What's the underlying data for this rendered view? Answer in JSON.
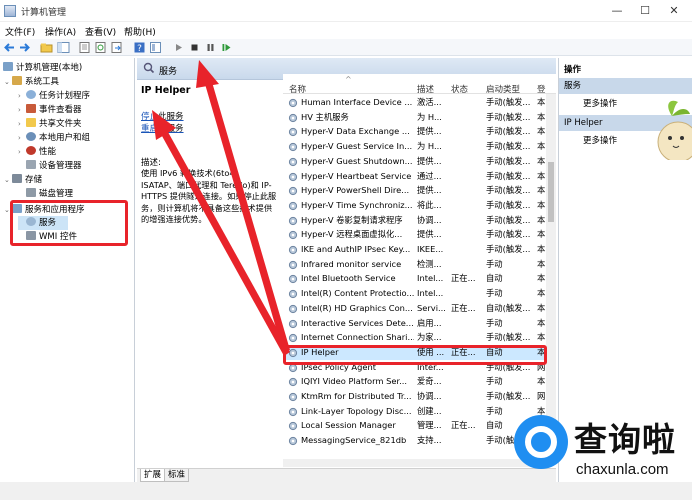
{
  "window": {
    "title": "计算机管理",
    "controls": [
      "minimize",
      "maximize",
      "close"
    ]
  },
  "menu": [
    "文件(F)",
    "操作(A)",
    "查看(V)",
    "帮助(H)"
  ],
  "toolbar_icons": [
    "back-icon",
    "forward-icon",
    "up-folder-icon",
    "show-hide-tree-icon",
    "properties-icon",
    "refresh-icon",
    "export-icon",
    "help-icon",
    "view-icon",
    "play-icon",
    "stop-icon",
    "pause-icon",
    "restart-icon"
  ],
  "tree": [
    {
      "label": "计算机管理(本地)",
      "level": 0,
      "expander": ""
    },
    {
      "label": "系统工具",
      "level": 1,
      "expander": "⌄"
    },
    {
      "label": "任务计划程序",
      "level": 2,
      "expander": "›"
    },
    {
      "label": "事件查看器",
      "level": 2,
      "expander": "›"
    },
    {
      "label": "共享文件夹",
      "level": 2,
      "expander": "›"
    },
    {
      "label": "本地用户和组",
      "level": 2,
      "expander": "›"
    },
    {
      "label": "性能",
      "level": 2,
      "expander": "›"
    },
    {
      "label": "设备管理器",
      "level": 2,
      "expander": ""
    },
    {
      "label": "存储",
      "level": 1,
      "expander": "⌄"
    },
    {
      "label": "磁盘管理",
      "level": 2,
      "expander": ""
    },
    {
      "label": "服务和应用程序",
      "level": 1,
      "expander": "⌄"
    },
    {
      "label": "服务",
      "level": 2,
      "expander": "",
      "selected": true
    },
    {
      "label": "WMI 控件",
      "level": 2,
      "expander": ""
    }
  ],
  "center": {
    "header_title": "服务",
    "selected_service": "IP Helper",
    "stop_link": "停止",
    "stop_suffix": "此服务",
    "restart_link": "重启",
    "restart_suffix": "此服务",
    "desc_label": "描述:",
    "description": "使用 IPv6 转换技术(6to4、ISATAP、端口代理和 Teredo)和 IP-HTTPS 提供隧道连接。如果停止此服务，则计算机将不具备这些技术提供的增强连接优势。"
  },
  "columns": [
    "名称",
    "描述",
    "状态",
    "启动类型",
    "登"
  ],
  "services": [
    {
      "name": "Human Interface Device ...",
      "desc": "激活...",
      "status": "",
      "startup": "手动(触发...",
      "logon": "本"
    },
    {
      "name": "HV 主机服务",
      "desc": "为 H...",
      "status": "",
      "startup": "手动(触发...",
      "logon": "本"
    },
    {
      "name": "Hyper-V Data Exchange ...",
      "desc": "提供...",
      "status": "",
      "startup": "手动(触发...",
      "logon": "本"
    },
    {
      "name": "Hyper-V Guest Service In...",
      "desc": "为 H...",
      "status": "",
      "startup": "手动(触发...",
      "logon": "本"
    },
    {
      "name": "Hyper-V Guest Shutdown...",
      "desc": "提供...",
      "status": "",
      "startup": "手动(触发...",
      "logon": "本"
    },
    {
      "name": "Hyper-V Heartbeat Service",
      "desc": "通过...",
      "status": "",
      "startup": "手动(触发...",
      "logon": "本"
    },
    {
      "name": "Hyper-V PowerShell Dire...",
      "desc": "提供...",
      "status": "",
      "startup": "手动(触发...",
      "logon": "本"
    },
    {
      "name": "Hyper-V Time Synchroniz...",
      "desc": "将此...",
      "status": "",
      "startup": "手动(触发...",
      "logon": "本"
    },
    {
      "name": "Hyper-V 卷影复制请求程序",
      "desc": "协调...",
      "status": "",
      "startup": "手动(触发...",
      "logon": "本"
    },
    {
      "name": "Hyper-V 远程桌面虚拟化...",
      "desc": "提供...",
      "status": "",
      "startup": "手动(触发...",
      "logon": "本"
    },
    {
      "name": "IKE and AuthIP IPsec Key...",
      "desc": "IKEE...",
      "status": "",
      "startup": "手动(触发...",
      "logon": "本"
    },
    {
      "name": "Infrared monitor service",
      "desc": "检测...",
      "status": "",
      "startup": "手动",
      "logon": "本"
    },
    {
      "name": "Intel Bluetooth Service",
      "desc": "Intel...",
      "status": "正在...",
      "startup": "自动",
      "logon": "本"
    },
    {
      "name": "Intel(R) Content Protectio...",
      "desc": "Intel...",
      "status": "",
      "startup": "手动",
      "logon": "本"
    },
    {
      "name": "Intel(R) HD Graphics Con...",
      "desc": "Servi...",
      "status": "正在...",
      "startup": "自动(触发...",
      "logon": "本"
    },
    {
      "name": "Interactive Services Dete...",
      "desc": "启用...",
      "status": "",
      "startup": "手动",
      "logon": "本"
    },
    {
      "name": "Internet Connection Shari...",
      "desc": "为家...",
      "status": "",
      "startup": "手动(触发...",
      "logon": "本"
    },
    {
      "name": "IP Helper",
      "desc": "使用 ...",
      "status": "正在...",
      "startup": "自动",
      "logon": "本",
      "selected": true
    },
    {
      "name": "IPsec Policy Agent",
      "desc": "Inter...",
      "status": "",
      "startup": "手动(触发...",
      "logon": "网"
    },
    {
      "name": "IQIYI Video Platform Ser...",
      "desc": "爱奇...",
      "status": "",
      "startup": "手动",
      "logon": "本"
    },
    {
      "name": "KtmRm for Distributed Tr...",
      "desc": "协调...",
      "status": "",
      "startup": "手动(触发...",
      "logon": "网"
    },
    {
      "name": "Link-Layer Topology Disc...",
      "desc": "创建...",
      "status": "",
      "startup": "手动",
      "logon": "本"
    },
    {
      "name": "Local Session Manager",
      "desc": "管理...",
      "status": "正在...",
      "startup": "自动",
      "logon": "本"
    },
    {
      "name": "MessagingService_821db",
      "desc": "支持...",
      "status": "",
      "startup": "手动(触发...",
      "logon": "本"
    }
  ],
  "tabs": [
    "扩展",
    "标准"
  ],
  "actions": {
    "title": "操作",
    "sections": [
      {
        "header": "服务",
        "item": "更多操作"
      },
      {
        "header": "IP Helper",
        "item": "更多操作"
      }
    ]
  },
  "watermark": {
    "brand": "查询啦",
    "domain": "chaxunla.com"
  },
  "colors": {
    "annotation": "#e8232a",
    "selection": "#cce8ff",
    "header": "#c9d9ec"
  }
}
